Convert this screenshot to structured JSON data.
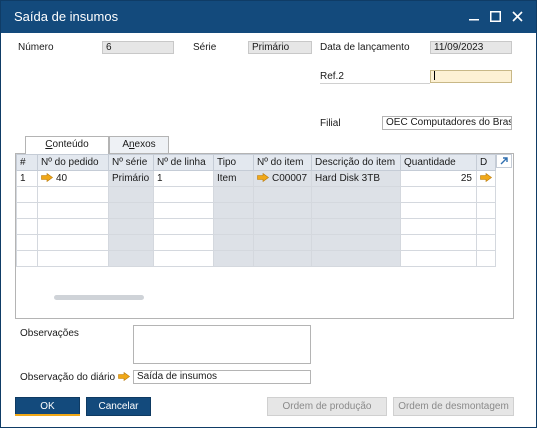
{
  "window": {
    "title": "Saída de insumos"
  },
  "header": {
    "numero_label": "Número",
    "numero_value": "6",
    "serie_label": "Série",
    "serie_value": "Primário",
    "data_label": "Data de lançamento",
    "data_value": "11/09/2023",
    "ref2_label": "Ref.2",
    "ref2_value": "",
    "filial_label": "Filial",
    "filial_value": "OEC Computadores do Brasil"
  },
  "tabs": [
    {
      "label_prefix": "",
      "label_underline": "C",
      "label_suffix": "onteúdo"
    },
    {
      "label_prefix": "A",
      "label_underline": "n",
      "label_suffix": "exos"
    }
  ],
  "grid": {
    "headers": [
      "#",
      "Nº do pedido",
      "Nº série",
      "Nº de linha",
      "Tipo",
      "Nº do item",
      "Descrição do item",
      "Quantidade",
      "D"
    ],
    "rows": [
      {
        "idx": "1",
        "pedido": "40",
        "serie": "Primário",
        "linha": "1",
        "tipo": "Item",
        "item": "C00007",
        "descricao": "Hard Disk 3TB",
        "quantidade": "25",
        "d": ""
      }
    ]
  },
  "footer": {
    "observacoes_label": "Observações",
    "observacoes_value": "",
    "obs_diario_label": "Observação do diário",
    "obs_diario_value": "Saída de insumos"
  },
  "buttons": {
    "ok": "OK",
    "cancel": "Cancelar",
    "ordem_producao": "Ordem de produção",
    "ordem_desmontagem": "Ordem de desmontagem"
  },
  "colors": {
    "titlebar": "#134a7c",
    "link_arrow": "#f0a818",
    "focus_field": "#fdf1d4"
  }
}
